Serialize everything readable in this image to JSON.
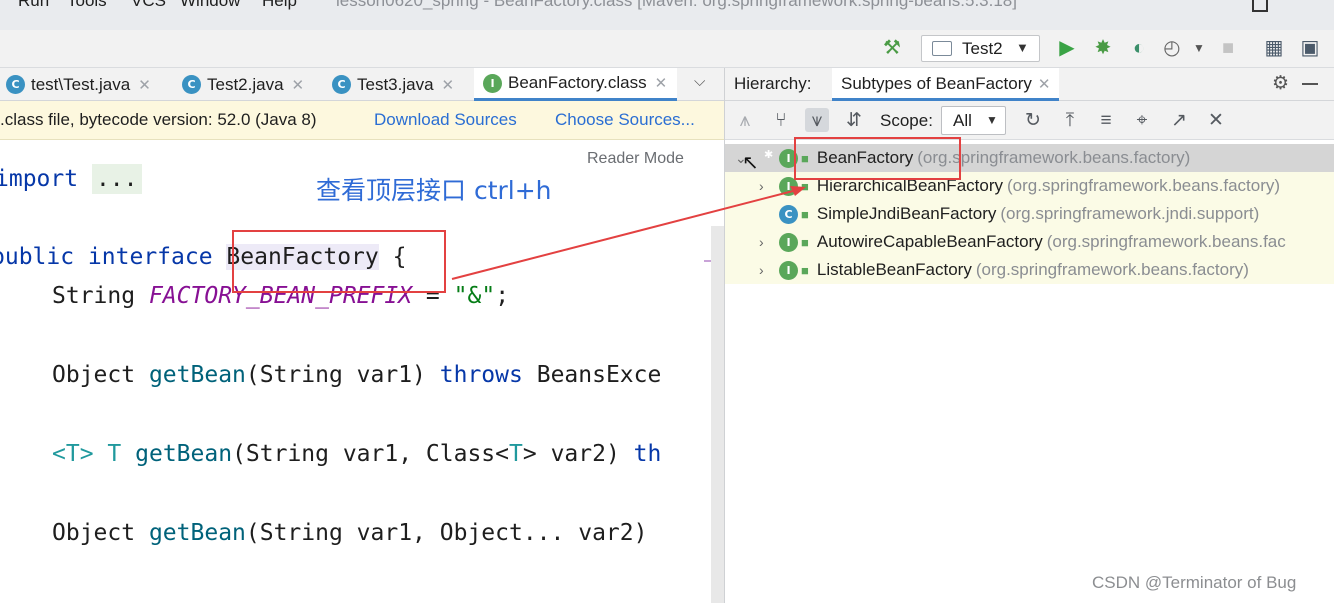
{
  "window": {
    "menu": [
      "Run",
      "Tools",
      "VCS",
      "Window",
      "Help"
    ],
    "title": "lesson0620_spring - BeanFactory.class [Maven: org.springframework:spring-beans:5.3.18]"
  },
  "toolbar": {
    "run_config": "Test2",
    "icons": [
      "build-hammer-icon",
      "run-icon",
      "debug-icon",
      "coverage-icon",
      "profiler-icon",
      "stop-icon",
      "project-structure-icon",
      "layout-icon"
    ]
  },
  "editor": {
    "tabs": [
      {
        "label": "test\\Test.java",
        "icon": "class-icon"
      },
      {
        "label": "Test2.java",
        "icon": "class-icon"
      },
      {
        "label": "Test3.java",
        "icon": "class-icon"
      },
      {
        "label": "BeanFactory.class",
        "icon": "interface-icon",
        "active": true
      }
    ],
    "notice": {
      "text": ".class file, bytecode version: 52.0 (Java 8)",
      "download_sources": "Download Sources",
      "choose_sources": "Choose Sources..."
    },
    "reader_mode": "Reader Mode",
    "annotation": "查看顶层接口 ctrl+h",
    "code": {
      "l1_kw": "import",
      "l1_fold": "...",
      "l2_kw": "public interface",
      "l2_name": "BeanFactory",
      "l2_brace": "{",
      "l3_type": "String",
      "l3_field": "FACTORY_BEAN_PREFIX",
      "l3_eq": "=",
      "l3_str": "\"&\"",
      "l3_end": ";",
      "l4_type": "Object",
      "l4_method": "getBean",
      "l4_params": "(String var1)",
      "l4_throws": "throws",
      "l4_exc": "BeansExce",
      "l5_generic": "<T>",
      "l5_t": "T",
      "l5_method": "getBean",
      "l5_params": "(String var1, Class<",
      "l5_t2": "T",
      "l5_params2": "> var2)",
      "l5_th": "th",
      "l6_type": "Object",
      "l6_method": "getBean",
      "l6_params": "(String var1, Object... var2)"
    }
  },
  "hierarchy": {
    "label": "Hierarchy:",
    "tab": "Subtypes of BeanFactory",
    "scope_label": "Scope:",
    "scope_value": "All",
    "tree": [
      {
        "name": "BeanFactory",
        "pkg": "(org.springframework.beans.factory)",
        "kind": "interface",
        "root": true
      },
      {
        "name": "HierarchicalBeanFactory",
        "pkg": "(org.springframework.beans.factory)",
        "kind": "interface",
        "expandable": true
      },
      {
        "name": "SimpleJndiBeanFactory",
        "pkg": "(org.springframework.jndi.support)",
        "kind": "class",
        "expandable": false
      },
      {
        "name": "AutowireCapableBeanFactory",
        "pkg": "(org.springframework.beans.fac",
        "kind": "interface",
        "expandable": true
      },
      {
        "name": "ListableBeanFactory",
        "pkg": "(org.springframework.beans.factory)",
        "kind": "interface",
        "expandable": true
      }
    ]
  },
  "watermark": "CSDN @Terminator of Bug",
  "colors": {
    "accent": "#4083c9",
    "annotation": "#2f6bd6",
    "highlight_box": "#e34141",
    "notice_bg": "#fdf8de"
  }
}
